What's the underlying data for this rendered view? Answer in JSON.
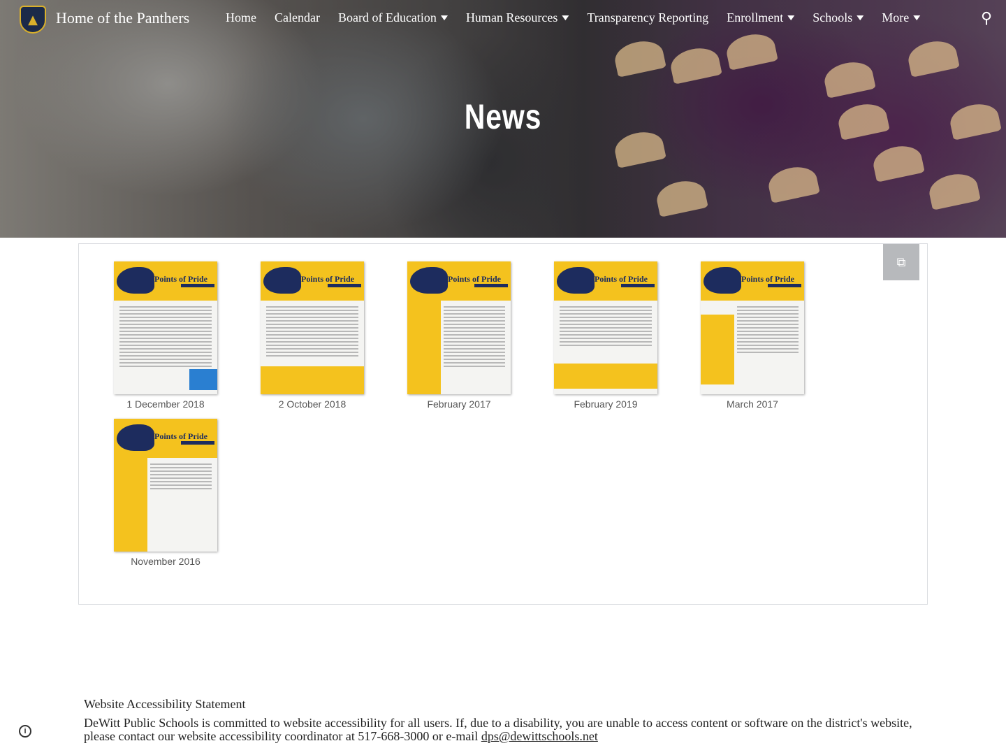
{
  "header": {
    "site_title": "Home of the Panthers",
    "nav": [
      {
        "label": "Home",
        "has_menu": false
      },
      {
        "label": "Calendar",
        "has_menu": false
      },
      {
        "label": "Board of Education",
        "has_menu": true
      },
      {
        "label": "Human Resources",
        "has_menu": true
      },
      {
        "label": "Transparency Reporting",
        "has_menu": false
      },
      {
        "label": "Enrollment",
        "has_menu": true
      },
      {
        "label": "Schools",
        "has_menu": true
      },
      {
        "label": "More",
        "has_menu": true
      }
    ],
    "search_icon": "search-icon",
    "logo_icon": "shield-logo-icon"
  },
  "hero": {
    "title": "News"
  },
  "gallery": {
    "open_icon": "open-in-new-icon",
    "items": [
      {
        "caption": "1 December 2018",
        "banner_text": "Points of Pride"
      },
      {
        "caption": "2 October 2018",
        "banner_text": "Points of Pride"
      },
      {
        "caption": "February 2017",
        "banner_text": "Points of Pride"
      },
      {
        "caption": "February 2019",
        "banner_text": "Points of Pride"
      },
      {
        "caption": "March 2017",
        "banner_text": "Points of Pride"
      },
      {
        "caption": "November 2016",
        "banner_text": "Points of Pride"
      }
    ]
  },
  "footer": {
    "accessibility_title": "Website Accessibility Statement",
    "accessibility_text": "DeWitt Public Schools is committed to website accessibility for all users. If, due to a disability, you are unable to access content or software on the district's website, please contact our website accessibility coordinator at 517-668-3000 or e-mail ",
    "email": "dps@dewittschools.net",
    "info_icon": "info-icon"
  },
  "colors": {
    "brand_gold": "#f4c21e",
    "brand_navy": "#1d2c5e"
  }
}
